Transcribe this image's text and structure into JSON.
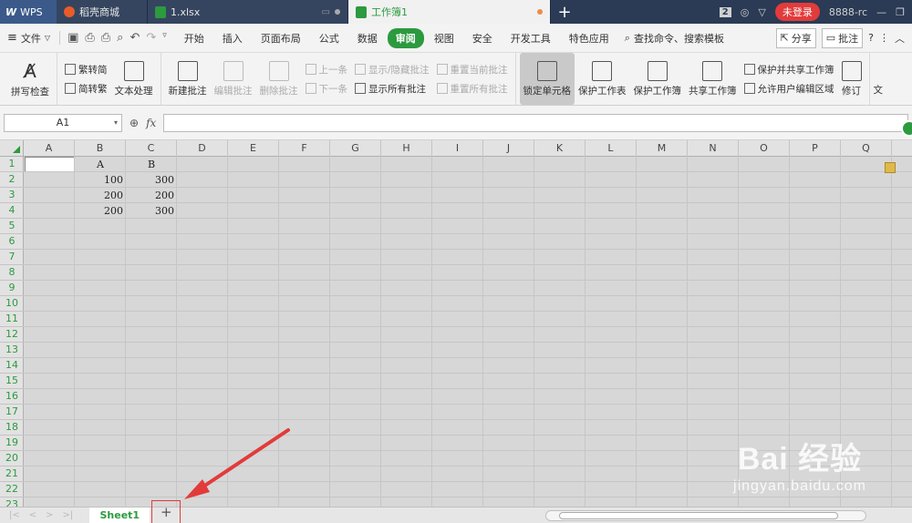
{
  "titlebar": {
    "app_name": "WPS",
    "tabs": [
      {
        "label": "稻壳商城"
      },
      {
        "label": "1.xlsx"
      },
      {
        "label": "工作簿1"
      }
    ],
    "window_count": "2",
    "login_label": "未登录",
    "user_id": "8888-rc"
  },
  "menubar": {
    "file_label": "文件",
    "tabs": [
      "开始",
      "插入",
      "页面布局",
      "公式",
      "数据",
      "审阅",
      "视图",
      "安全",
      "开发工具",
      "特色应用"
    ],
    "active_tab": "审阅",
    "search_label": "查找命令、搜索模板",
    "share_label": "分享",
    "comment_label": "批注"
  },
  "ribbon": {
    "spell_check": "拼写检查",
    "trad": "繁转简",
    "simp": "简转繁",
    "text_process": "文本处理",
    "new_comment": "新建批注",
    "edit_comment": "编辑批注",
    "delete_comment": "删除批注",
    "prev": "上一条",
    "next": "下一条",
    "show_hide_comment": "显示/隐藏批注",
    "show_all_comments": "显示所有批注",
    "reset_current": "重置当前批注",
    "reset_all": "重置所有批注",
    "lock_cell": "锁定单元格",
    "protect_sheet": "保护工作表",
    "protect_book": "保护工作簿",
    "share_book": "共享工作簿",
    "protect_share": "保护并共享工作簿",
    "allow_edit": "允许用户编辑区域",
    "revise": "修订",
    "more": "文"
  },
  "formula": {
    "name_box": "A1",
    "fx_label": "fx",
    "value": ""
  },
  "grid": {
    "columns": [
      "A",
      "B",
      "C",
      "D",
      "E",
      "F",
      "G",
      "H",
      "I",
      "J",
      "K",
      "L",
      "M",
      "N",
      "O",
      "P",
      "Q"
    ],
    "rows": [
      "1",
      "2",
      "3",
      "4",
      "5",
      "6",
      "7",
      "8",
      "9",
      "10",
      "11",
      "12",
      "13",
      "14",
      "15",
      "16",
      "17",
      "18",
      "19",
      "20",
      "21",
      "22",
      "23"
    ],
    "data": {
      "B1": "A",
      "C1": "B",
      "B2": "100",
      "C2": "300",
      "B3": "200",
      "C3": "200",
      "B4": "200",
      "C4": "300"
    }
  },
  "sheetbar": {
    "sheet_tab": "Sheet1",
    "add_label": "+"
  },
  "watermark": {
    "logo": "Bai 经验",
    "url": "jingyan.baidu.com"
  },
  "colors": {
    "accent": "#2c9a3f",
    "titlebar": "#2b3a55",
    "login": "#e23b3b",
    "annotation": "#e23b3b"
  }
}
